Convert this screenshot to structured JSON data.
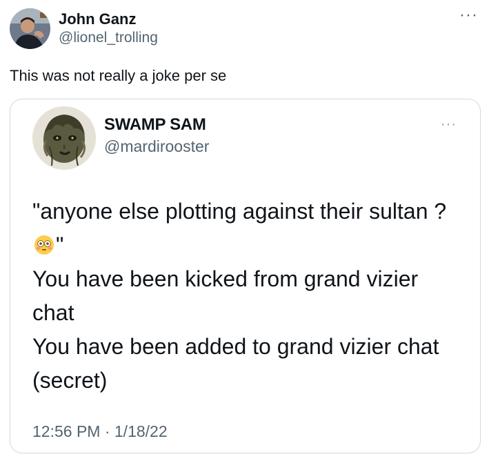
{
  "tweet": {
    "author": {
      "display_name": "John Ganz",
      "handle": "@lionel_trolling",
      "avatar_icon": "profile-photo"
    },
    "more_icon": "more-options-icon",
    "more_glyph": "···",
    "text": "This was not really a joke per se",
    "quoted": {
      "author": {
        "display_name": "SWAMP SAM",
        "handle": "@mardirooster",
        "avatar_icon": "swamp-thing-avatar"
      },
      "more_glyph": "···",
      "lines": [
        "\"anyone else plotting against their sultan ? ",
        "\"",
        "You have been kicked from grand vizier chat",
        "You have been added to grand vizier chat (secret)"
      ],
      "emoji": "flushed-face-emoji",
      "timestamp": "12:56 PM · 1/18/22"
    }
  },
  "colors": {
    "text": "#0f1419",
    "secondary": "#536471",
    "border": "#cfd9de"
  }
}
